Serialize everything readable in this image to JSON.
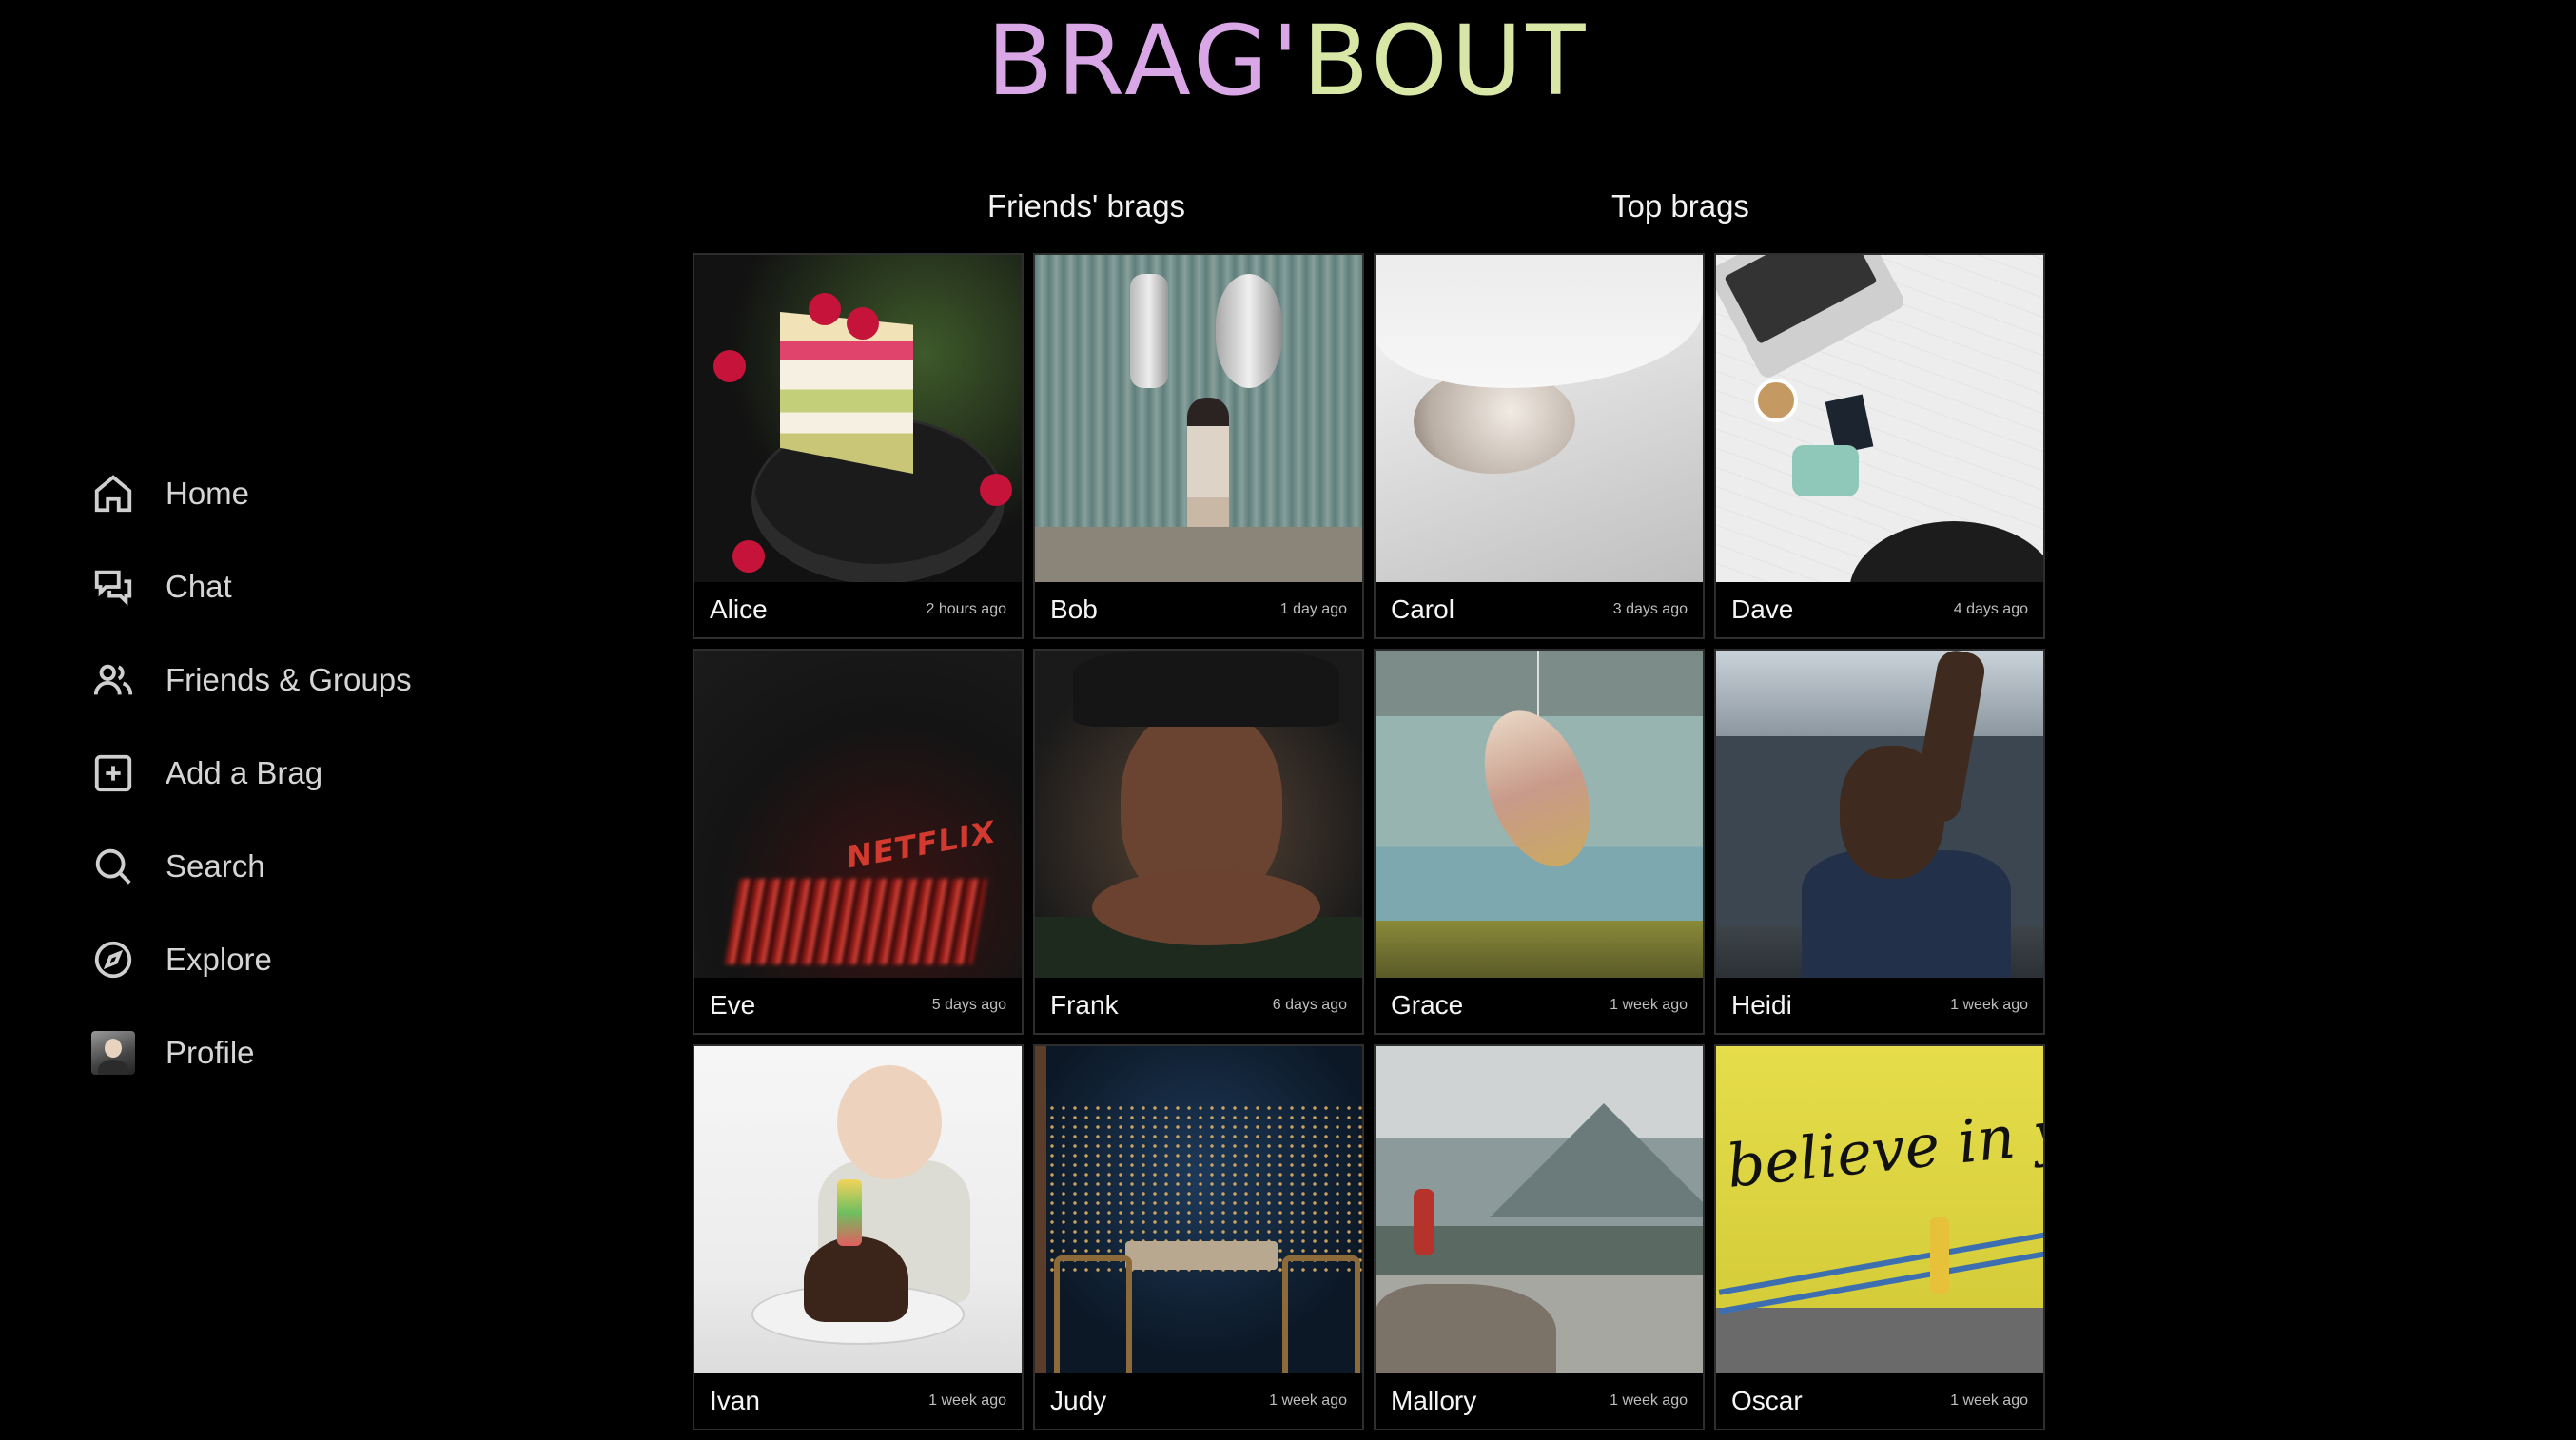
{
  "logo": {
    "part1": "BRAG'",
    "part2": "BOUT"
  },
  "nav": {
    "items": [
      {
        "label": "Home",
        "icon": "home-icon"
      },
      {
        "label": "Chat",
        "icon": "chat-icon"
      },
      {
        "label": "Friends & Groups",
        "icon": "friends-icon"
      },
      {
        "label": "Add a Brag",
        "icon": "add-icon"
      },
      {
        "label": "Search",
        "icon": "search-icon"
      },
      {
        "label": "Explore",
        "icon": "compass-icon"
      },
      {
        "label": "Profile",
        "icon": "avatar"
      }
    ]
  },
  "sections": {
    "friends": "Friends' brags",
    "top": "Top brags"
  },
  "brags": [
    {
      "name": "Alice",
      "time": "2 hours ago",
      "photo": "cake-photo"
    },
    {
      "name": "Bob",
      "time": "1 day ago",
      "photo": "balloons-photo"
    },
    {
      "name": "Carol",
      "time": "3 days ago",
      "photo": "cat-photo"
    },
    {
      "name": "Dave",
      "time": "4 days ago",
      "photo": "travel-map-photo"
    },
    {
      "name": "Eve",
      "time": "5 days ago",
      "photo": "netflix-photo",
      "photo_text": "NETFLIX"
    },
    {
      "name": "Frank",
      "time": "6 days ago",
      "photo": "graduation-photo"
    },
    {
      "name": "Grace",
      "time": "1 week ago",
      "photo": "fish-photo"
    },
    {
      "name": "Heidi",
      "time": "1 week ago",
      "photo": "car-photo"
    },
    {
      "name": "Ivan",
      "time": "1 week ago",
      "photo": "baby-birthday-photo"
    },
    {
      "name": "Judy",
      "time": "1 week ago",
      "photo": "city-dinner-photo"
    },
    {
      "name": "Mallory",
      "time": "1 week ago",
      "photo": "mountain-photo"
    },
    {
      "name": "Oscar",
      "time": "1 week ago",
      "photo": "believe-wall-photo",
      "photo_text": "believe in yourself"
    }
  ]
}
